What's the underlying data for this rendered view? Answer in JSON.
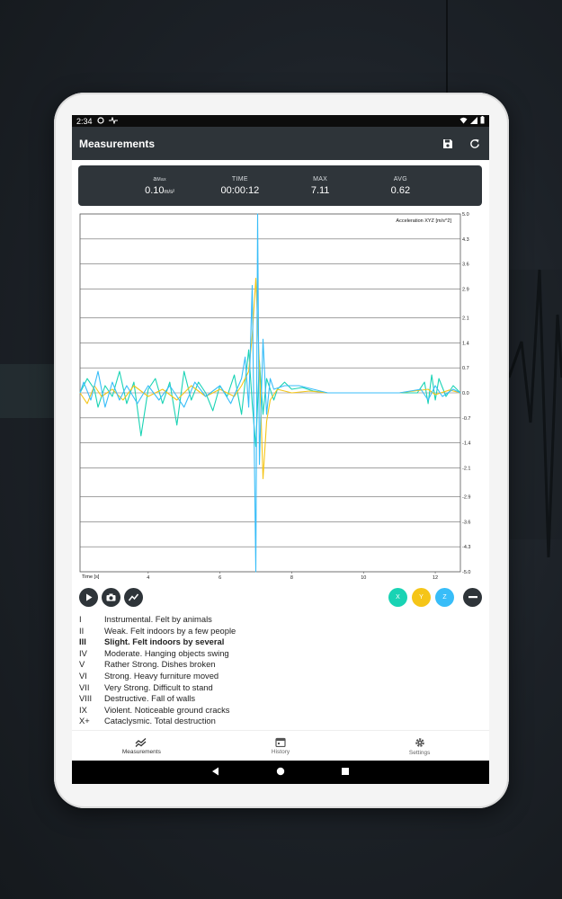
{
  "status_bar": {
    "time": "2:34"
  },
  "app_bar": {
    "title": "Measurements"
  },
  "stats": [
    {
      "label": "a",
      "label_sub": "Max",
      "value": "0.10",
      "unit": "m/s²"
    },
    {
      "label": "TIME",
      "value": "00:00:12",
      "unit": ""
    },
    {
      "label": "MAX",
      "value": "7.11",
      "unit": ""
    },
    {
      "label": "AVG",
      "value": "0.62",
      "unit": ""
    }
  ],
  "chart_data": {
    "type": "line",
    "title": "Acceleration XYZ [m/s^2]",
    "xlabel": "Time [s]",
    "ylabel": "",
    "xlim": [
      2.1,
      12.7
    ],
    "ylim": [
      -5.0,
      5.0
    ],
    "x_ticks": [
      4,
      6,
      8,
      10,
      12
    ],
    "y_ticks": [
      5.0,
      4.3,
      3.6,
      2.9,
      2.1,
      1.4,
      0.7,
      0.0,
      -0.7,
      -1.4,
      -2.1,
      -2.9,
      -3.6,
      -4.3,
      -5.0
    ],
    "grid": true,
    "series": [
      {
        "color": "#19d3b4",
        "points": [
          [
            2.1,
            0.0
          ],
          [
            2.3,
            0.4
          ],
          [
            2.5,
            0.1
          ],
          [
            2.6,
            -0.4
          ],
          [
            2.8,
            0.2
          ],
          [
            3.0,
            -0.1
          ],
          [
            3.2,
            0.6
          ],
          [
            3.4,
            -0.3
          ],
          [
            3.6,
            0.3
          ],
          [
            3.8,
            -1.2
          ],
          [
            4.0,
            0.1
          ],
          [
            4.2,
            0.4
          ],
          [
            4.4,
            -0.3
          ],
          [
            4.6,
            0.3
          ],
          [
            4.8,
            -0.9
          ],
          [
            5.0,
            0.6
          ],
          [
            5.2,
            -0.2
          ],
          [
            5.4,
            0.3
          ],
          [
            5.6,
            0.0
          ],
          [
            5.8,
            -0.5
          ],
          [
            6.0,
            0.2
          ],
          [
            6.2,
            -0.1
          ],
          [
            6.4,
            0.5
          ],
          [
            6.6,
            -0.6
          ],
          [
            6.8,
            1.2
          ],
          [
            6.9,
            -0.3
          ],
          [
            7.0,
            -1.5
          ],
          [
            7.1,
            0.9
          ],
          [
            7.2,
            -0.6
          ],
          [
            7.3,
            0.4
          ],
          [
            7.5,
            -0.2
          ],
          [
            7.6,
            0.1
          ],
          [
            7.8,
            0.3
          ],
          [
            8.0,
            0.1
          ],
          [
            8.3,
            0.15
          ],
          [
            8.6,
            0.05
          ],
          [
            9.0,
            0.0
          ],
          [
            9.5,
            0.0
          ],
          [
            10.0,
            0.0
          ],
          [
            10.5,
            0.0
          ],
          [
            11.0,
            0.0
          ],
          [
            11.5,
            0.0
          ],
          [
            11.7,
            0.3
          ],
          [
            11.8,
            -0.3
          ],
          [
            11.9,
            0.5
          ],
          [
            12.0,
            -0.2
          ],
          [
            12.1,
            0.4
          ],
          [
            12.3,
            -0.1
          ],
          [
            12.5,
            0.2
          ],
          [
            12.7,
            0.0
          ]
        ]
      },
      {
        "color": "#f5c518",
        "points": [
          [
            2.1,
            0.0
          ],
          [
            2.3,
            -0.3
          ],
          [
            2.5,
            0.2
          ],
          [
            2.7,
            -0.1
          ],
          [
            3.0,
            0.1
          ],
          [
            3.3,
            -0.2
          ],
          [
            3.6,
            0.2
          ],
          [
            4.0,
            -0.1
          ],
          [
            4.4,
            0.1
          ],
          [
            4.8,
            -0.2
          ],
          [
            5.2,
            0.2
          ],
          [
            5.6,
            -0.1
          ],
          [
            6.0,
            0.1
          ],
          [
            6.4,
            -0.1
          ],
          [
            6.6,
            0.2
          ],
          [
            6.8,
            0.6
          ],
          [
            6.9,
            1.6
          ],
          [
            7.0,
            3.2
          ],
          [
            7.1,
            0.8
          ],
          [
            7.2,
            -2.4
          ],
          [
            7.3,
            -0.8
          ],
          [
            7.4,
            -0.2
          ],
          [
            7.6,
            0.1
          ],
          [
            8.0,
            0.0
          ],
          [
            8.5,
            0.05
          ],
          [
            9.0,
            0.0
          ],
          [
            10.0,
            0.0
          ],
          [
            11.0,
            0.0
          ],
          [
            11.8,
            0.1
          ],
          [
            12.0,
            -0.05
          ],
          [
            12.4,
            0.08
          ],
          [
            12.7,
            0.0
          ]
        ]
      },
      {
        "color": "#38bdf8",
        "points": [
          [
            2.1,
            0.0
          ],
          [
            2.2,
            0.3
          ],
          [
            2.4,
            -0.2
          ],
          [
            2.6,
            0.6
          ],
          [
            2.8,
            -0.4
          ],
          [
            3.0,
            0.3
          ],
          [
            3.2,
            -0.2
          ],
          [
            3.4,
            0.2
          ],
          [
            3.7,
            -0.3
          ],
          [
            4.0,
            0.2
          ],
          [
            4.3,
            -0.2
          ],
          [
            4.6,
            0.2
          ],
          [
            5.0,
            -0.4
          ],
          [
            5.3,
            0.3
          ],
          [
            5.6,
            -0.1
          ],
          [
            6.0,
            0.2
          ],
          [
            6.3,
            -0.3
          ],
          [
            6.6,
            0.4
          ],
          [
            6.7,
            1.0
          ],
          [
            6.8,
            -0.4
          ],
          [
            6.9,
            3.0
          ],
          [
            7.0,
            -5.0
          ],
          [
            7.05,
            5.0
          ],
          [
            7.1,
            -2.0
          ],
          [
            7.2,
            1.5
          ],
          [
            7.3,
            -0.6
          ],
          [
            7.4,
            0.4
          ],
          [
            7.5,
            0.1
          ],
          [
            7.8,
            0.2
          ],
          [
            8.2,
            0.2
          ],
          [
            8.6,
            0.1
          ],
          [
            9.0,
            0.0
          ],
          [
            10.0,
            0.0
          ],
          [
            11.0,
            0.0
          ],
          [
            11.6,
            0.1
          ],
          [
            11.8,
            -0.2
          ],
          [
            12.0,
            0.2
          ],
          [
            12.2,
            -0.1
          ],
          [
            12.5,
            0.1
          ],
          [
            12.7,
            0.0
          ]
        ]
      }
    ]
  },
  "chips": {
    "x": "X",
    "y": "Y",
    "z": "Z"
  },
  "scale": [
    {
      "num": "I",
      "desc": "Instrumental. Felt by animals",
      "bold": false
    },
    {
      "num": "II",
      "desc": "Weak. Felt indoors by a few people",
      "bold": false
    },
    {
      "num": "III",
      "desc": "Slight. Felt indoors by several",
      "bold": true
    },
    {
      "num": "IV",
      "desc": "Moderate. Hanging objects swing",
      "bold": false
    },
    {
      "num": "V",
      "desc": "Rather Strong. Dishes broken",
      "bold": false
    },
    {
      "num": "VI",
      "desc": "Strong. Heavy furniture moved",
      "bold": false
    },
    {
      "num": "VII",
      "desc": "Very Strong. Difficult to stand",
      "bold": false
    },
    {
      "num": "VIII",
      "desc": "Destructive. Fall of walls",
      "bold": false
    },
    {
      "num": "IX",
      "desc": "Violent. Noticeable ground cracks",
      "bold": false
    },
    {
      "num": "X+",
      "desc": "Cataclysmic. Total destruction",
      "bold": false
    }
  ],
  "bottom_nav": [
    {
      "label": "Measurements",
      "icon": "chart-icon"
    },
    {
      "label": "History",
      "icon": "calendar-icon"
    },
    {
      "label": "Settings",
      "icon": "gear-icon"
    }
  ]
}
